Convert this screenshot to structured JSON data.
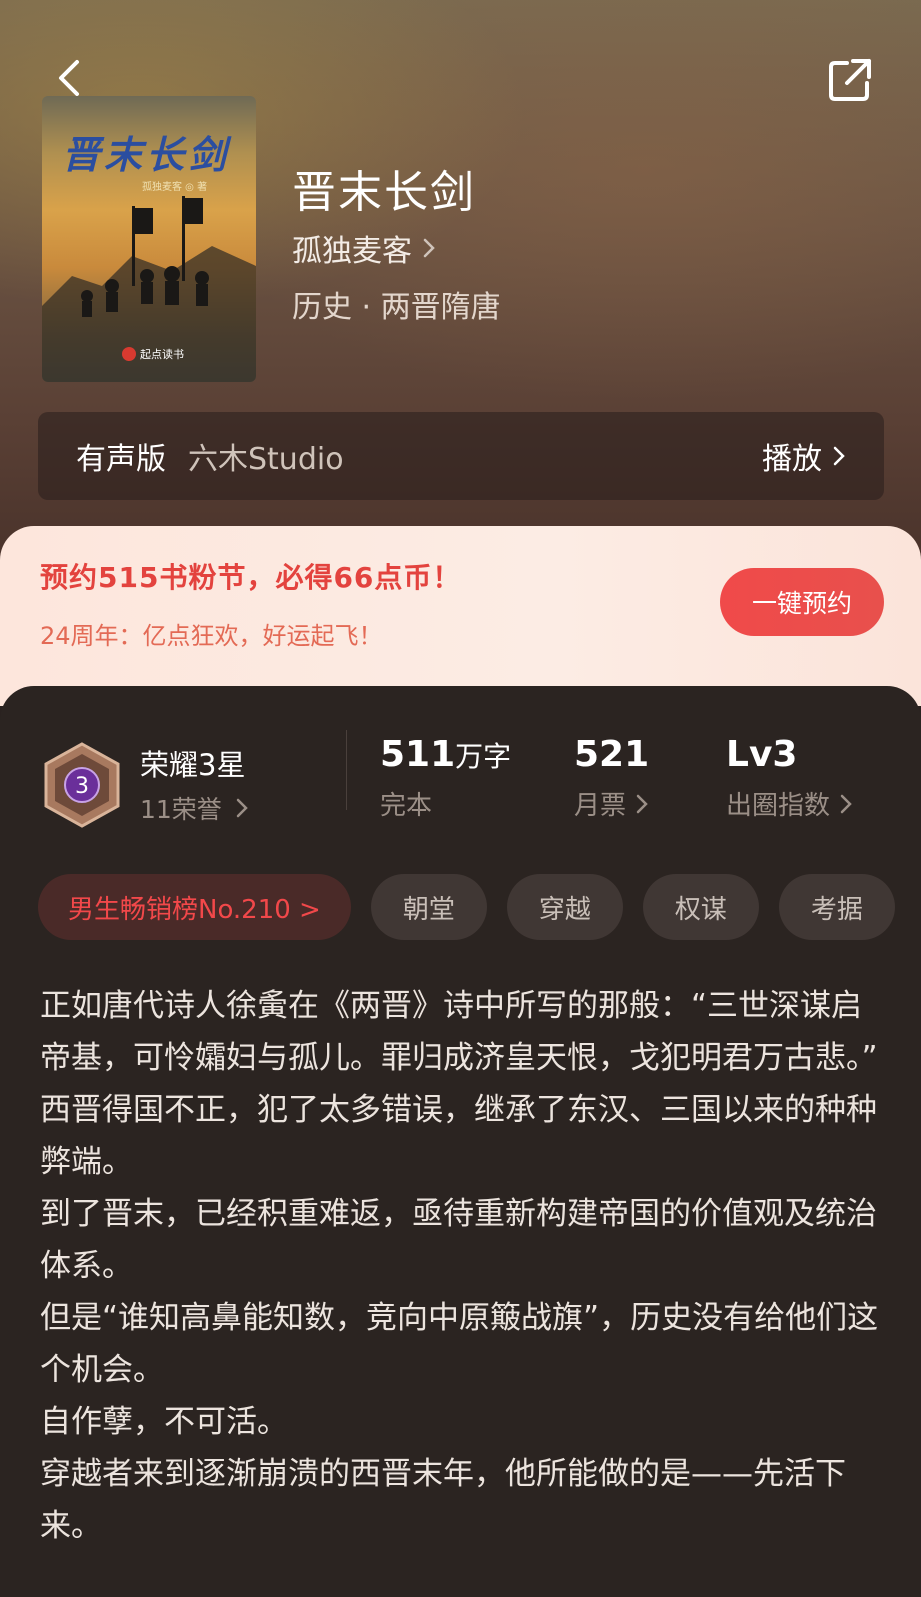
{
  "book": {
    "title": "晋末长剑",
    "author": "孤独麦客",
    "genre": "历史 · 两晋隋唐",
    "cover": {
      "title": "晋末长剑",
      "author_line": "孤独麦客 ◎ 著",
      "publisher": "起点读书"
    }
  },
  "audio": {
    "label": "有声版",
    "studio": "六木Studio",
    "play_label": "播放"
  },
  "promo": {
    "title": "预约515书粉节，必得66点币！",
    "subtitle": "24周年：亿点狂欢，好运起飞！",
    "button_label": "一键预约"
  },
  "honor": {
    "badge_level": "3",
    "title": "荣耀3星",
    "subtitle": "11荣誉"
  },
  "stats": {
    "words_value": "511",
    "words_unit": "万字",
    "words_label": "完本",
    "tickets_value": "521",
    "tickets_label": "月票",
    "index_value": "Lv3",
    "index_label": "出圈指数"
  },
  "tags": {
    "rank": "男生畅销榜No.210 >",
    "items": [
      "朝堂",
      "穿越",
      "权谋",
      "考据"
    ]
  },
  "description": [
    "正如唐代诗人徐夤在《两晋》诗中所写的那般：“三世深谋启帝基，可怜孀妇与孤儿。罪归成济皇天恨，戈犯明君万古悲。”",
    "西晋得国不正，犯了太多错误，继承了东汉、三国以来的种种弊端。",
    "到了晋末，已经积重难返，亟待重新构建帝国的价值观及统治体系。",
    "但是“谁知高鼻能知数，竞向中原簸战旗”，历史没有给他们这个机会。",
    "自作孽，不可活。",
    "穿越者来到逐渐崩溃的西晋末年，他所能做的是——先活下来。"
  ],
  "colors": {
    "accent_red": "#e3433e",
    "panel_bg": "#2b2421",
    "badge_purple": "#6a2f9a"
  },
  "icons": [
    "back-icon",
    "share-icon",
    "chevron-right-icon",
    "honor-badge-icon"
  ]
}
